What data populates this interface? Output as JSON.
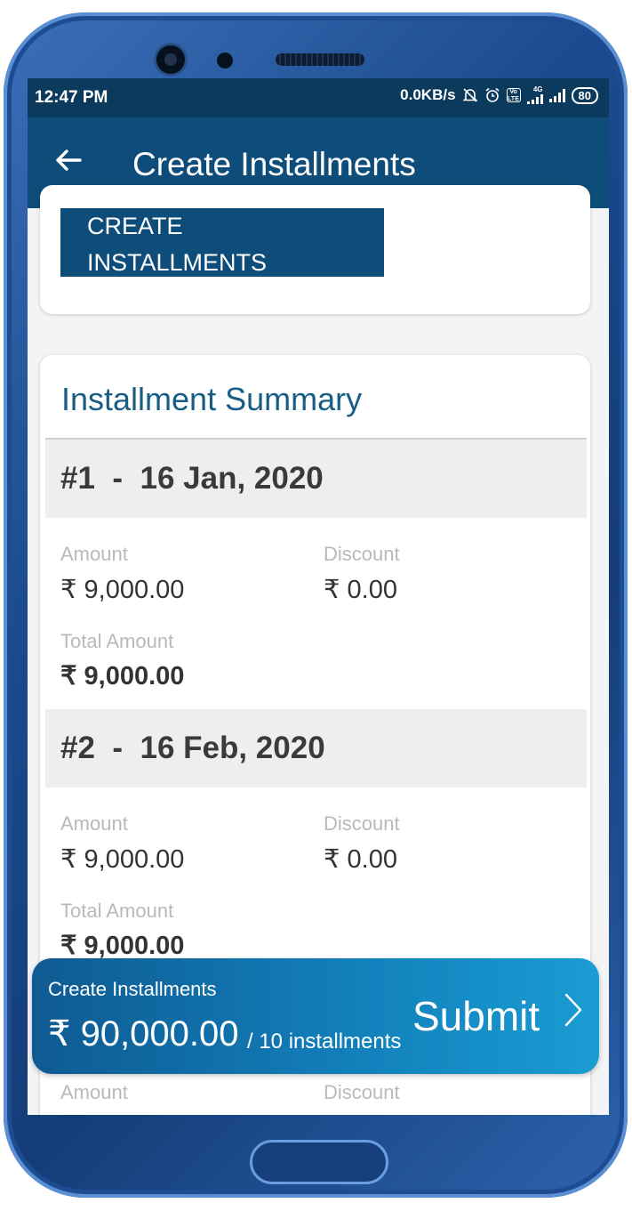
{
  "status_bar": {
    "time": "12:47 PM",
    "speed": "0.0KB/s",
    "battery": "80",
    "network_small": "4G",
    "volte": "Vo LTE"
  },
  "app_bar": {
    "title": "Create Installments"
  },
  "top_card": {
    "button_line1": "CREATE",
    "button_line2": "INSTALLMENTS"
  },
  "summary": {
    "title": "Installment Summary",
    "installments": [
      {
        "header": "#1  -  16 Jan, 2020",
        "amount_label": "Amount",
        "amount": "₹ 9,000.00",
        "discount_label": "Discount",
        "discount": "₹ 0.00",
        "total_label": "Total Amount",
        "total": "₹ 9,000.00"
      },
      {
        "header": "#2  -  16 Feb, 2020",
        "amount_label": "Amount",
        "amount": "₹ 9,000.00",
        "discount_label": "Discount",
        "discount": "₹ 0.00",
        "total_label": "Total Amount",
        "total": "₹ 9,000.00"
      },
      {
        "amount_label": "Amount",
        "discount_label": "Discount"
      }
    ]
  },
  "footer": {
    "caption": "Create Installments",
    "total": "₹ 90,000.00",
    "count": "/ 10 installments",
    "submit_label": "Submit"
  }
}
